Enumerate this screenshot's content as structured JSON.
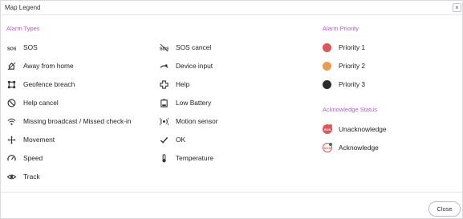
{
  "dialog": {
    "title": "Map Legend",
    "close_icon": "×",
    "close_button": "Close"
  },
  "alarm_types": {
    "title": "Alarm Types",
    "column1": [
      {
        "label": "SOS",
        "icon": "sos-icon"
      },
      {
        "label": "Away from home",
        "icon": "away-from-home-icon"
      },
      {
        "label": "Geofence breach",
        "icon": "geofence-icon"
      },
      {
        "label": "Help cancel",
        "icon": "help-cancel-icon"
      },
      {
        "label": "Missing broadcast / Missed check-in",
        "icon": "missing-broadcast-icon"
      },
      {
        "label": "Movement",
        "icon": "movement-icon"
      },
      {
        "label": "Speed",
        "icon": "speed-icon"
      },
      {
        "label": "Track",
        "icon": "track-icon"
      }
    ],
    "column2": [
      {
        "label": "SOS cancel",
        "icon": "sos-cancel-icon"
      },
      {
        "label": "Device input",
        "icon": "device-input-icon"
      },
      {
        "label": "Help",
        "icon": "help-icon"
      },
      {
        "label": "Low Battery",
        "icon": "battery-icon"
      },
      {
        "label": "Motion sensor",
        "icon": "motion-sensor-icon"
      },
      {
        "label": "OK",
        "icon": "check-icon"
      },
      {
        "label": "Temperature",
        "icon": "thermometer-icon"
      }
    ]
  },
  "alarm_priority": {
    "title": "Alarm Priority",
    "items": [
      {
        "label": "Priority 1",
        "color": "#e0555a"
      },
      {
        "label": "Priority 2",
        "color": "#ee9a4a"
      },
      {
        "label": "Priority 3",
        "color": "#2b2b2b"
      }
    ]
  },
  "acknowledge_status": {
    "title": "Acknowledge Status",
    "items": [
      {
        "label": "Unacknowledge",
        "badge": "SOS",
        "badge_color": "#e0555a",
        "pip_color": "#e0555a"
      },
      {
        "label": "Acknowledge",
        "badge": "SOS",
        "badge_color": "#ffffff",
        "pip_color": "#2e7d4a"
      }
    ]
  },
  "colors": {
    "section_title": "#b45bc9",
    "icon": "#333333"
  }
}
